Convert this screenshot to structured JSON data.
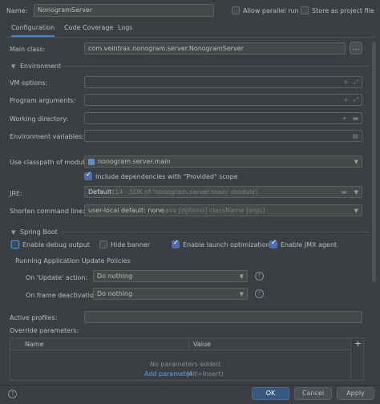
{
  "header": {
    "name_label": "Name:",
    "name_value": "NonogramServer",
    "allow_parallel": "Allow parallel run",
    "store_as_file": "Store as project file"
  },
  "tabs": [
    {
      "label": "Configuration"
    },
    {
      "label": "Code Coverage"
    },
    {
      "label": "Logs"
    }
  ],
  "main_class": {
    "label": "Main class:",
    "value": "com.veintrax.nonogram.server.NonogramServer",
    "browse": "..."
  },
  "environment": {
    "section": "Environment",
    "vm_options": "VM options:",
    "program_args": "Program arguments:",
    "working_dir": "Working directory:",
    "env_vars": "Environment variables:"
  },
  "classpath": {
    "label": "Use classpath of module:",
    "value": "nonogram.server.main",
    "include_provided": "Include dependencies with \"Provided\" scope"
  },
  "jre": {
    "label": "JRE:",
    "value_bold": "Default",
    "value_dim": "(14 - SDK of 'nonogram.server.main' module)"
  },
  "shorten": {
    "label": "Shorten command line:",
    "value": "user-local default: none",
    "value_dim": "- java [options] className [args]"
  },
  "spring": {
    "section": "Spring Boot",
    "debug_output": "Enable debug output",
    "hide_banner": "Hide banner",
    "launch_opt": "Enable launch optimization",
    "jmx_agent": "Enable JMX agent",
    "policies_title": "Running Application Update Policies",
    "on_update_label": "On 'Update' action:",
    "on_update_value": "Do nothing",
    "on_frame_label": "On frame deactivation:",
    "on_frame_value": "Do nothing",
    "active_profiles": "Active profiles:",
    "override_params": "Override parameters:"
  },
  "params_table": {
    "col_name": "Name",
    "col_value": "Value",
    "empty": "No parameters added.",
    "add_link": "Add parameter",
    "add_hint": "(Alt+Insert)"
  },
  "footer": {
    "ok": "OK",
    "cancel": "Cancel",
    "apply": "Apply"
  }
}
